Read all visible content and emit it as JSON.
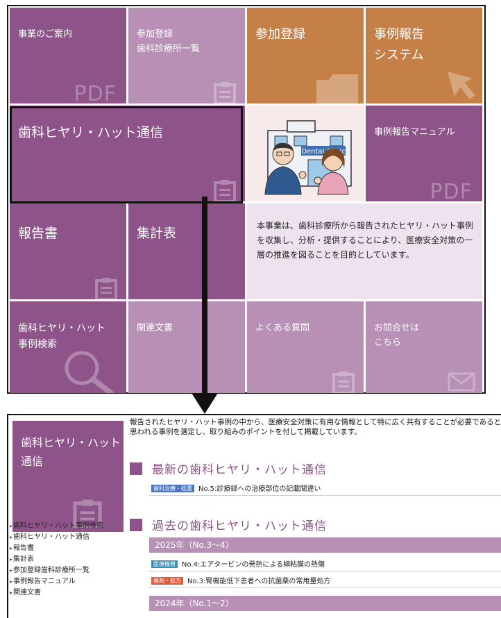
{
  "tiles": {
    "business": "事業のご案内",
    "participants": "参加登録\n歯科診療所一覧",
    "register": "参加登録",
    "report_system": "事例報告\nシステム",
    "tsushin": "歯科ヒヤリ・ハット通信",
    "manual": "事例報告マニュアル",
    "report": "報告書",
    "tally": "集計表",
    "info": "本事業は、歯科診療所から報告されたヒヤリ・ハット事例を収集し、分析・提供することにより、医療安全対策の一層の推進を図ることを目的としています。",
    "search": "歯科ヒヤリ・ハット\n事例検索",
    "related": "関連文書",
    "faq": "よくある質問",
    "contact": "お問合せは\nこちら",
    "pdf_label": "PDF",
    "illustration_sign": "Dental Clinic"
  },
  "detail": {
    "side_title": "歯科ヒヤリ・ハット\n通信",
    "side_links": [
      "歯科ヒヤリ・ハット事例検索",
      "歯科ヒヤリ・ハット通信",
      "報告書",
      "集計表",
      "参加登録歯科診療所一覧",
      "事例報告マニュアル",
      "関連文書"
    ],
    "intro": "報告されたヒヤリ・ハット事例の中から、医療安全対策に有用な情報として特に広く共有することが必要であると思われる事例を選定し、取り組みのポイントを付して掲載しています。",
    "latest_title": "最新の歯科ヒヤリ・ハット通信",
    "latest_item": {
      "badge": "歯科治療・処置",
      "title": "No.5:診療録への治療部位の記載間違い"
    },
    "past_title": "過去の歯科ヒヤリ・ハット通信",
    "year_2025": "2025年（No.3〜4）",
    "items_2025": [
      {
        "badge": "医療機器",
        "title": "No.4:エアタービンの発熱による頬粘膜の熱傷"
      },
      {
        "badge": "薬剤・処方",
        "title": "No.3:腎機能低下患者への抗菌薬の常用量処方"
      }
    ],
    "year_2024": "2024年（No.1〜2）"
  },
  "colors": {
    "purple": "#8e5389",
    "lilac": "#b88fb5",
    "orange": "#c58047",
    "pale": "#efe2ef"
  }
}
